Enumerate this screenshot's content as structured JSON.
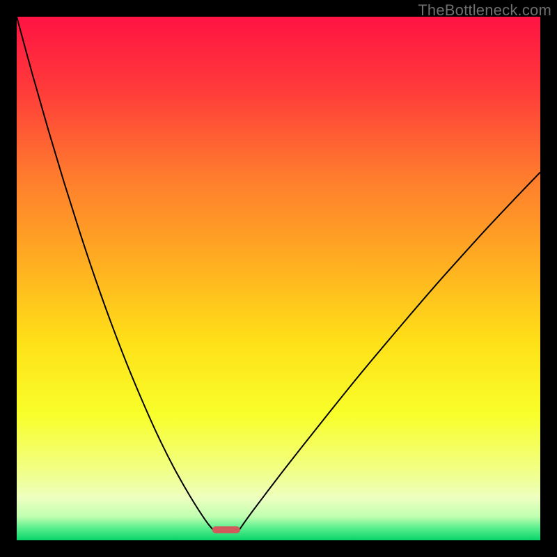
{
  "watermark": "TheBottleneck.com",
  "chart_data": {
    "type": "line",
    "title": "",
    "xlabel": "",
    "ylabel": "",
    "xlim": [
      0,
      100
    ],
    "ylim": [
      0,
      100
    ],
    "grid": false,
    "series": [
      {
        "name": "left-curve",
        "x": [
          0,
          3,
          6,
          9,
          12,
          15,
          18,
          21,
          24,
          27,
          30,
          33,
          36,
          37.5
        ],
        "y": [
          100,
          89,
          78.5,
          68.5,
          59,
          50,
          41.6,
          33.8,
          26.6,
          19.9,
          13.9,
          8.6,
          3.9,
          2.0
        ]
      },
      {
        "name": "right-curve",
        "x": [
          42.5,
          45,
          50,
          55,
          60,
          65,
          70,
          75,
          80,
          85,
          90,
          95,
          100
        ],
        "y": [
          2.0,
          5.5,
          12.1,
          18.5,
          24.8,
          31.0,
          37.0,
          42.9,
          48.7,
          54.3,
          59.8,
          65.1,
          70.3
        ]
      }
    ],
    "annotations": [
      {
        "name": "minimum-marker",
        "x": 40,
        "y": 2.0,
        "color": "#d15a5a"
      }
    ],
    "background_gradient": {
      "stops": [
        {
          "offset": 0.0,
          "color": "#ff1343"
        },
        {
          "offset": 0.14,
          "color": "#ff3b3a"
        },
        {
          "offset": 0.3,
          "color": "#ff7a2e"
        },
        {
          "offset": 0.46,
          "color": "#ffab22"
        },
        {
          "offset": 0.62,
          "color": "#ffe018"
        },
        {
          "offset": 0.76,
          "color": "#f8ff2a"
        },
        {
          "offset": 0.86,
          "color": "#f2ff80"
        },
        {
          "offset": 0.92,
          "color": "#edffc0"
        },
        {
          "offset": 0.955,
          "color": "#c0ffb0"
        },
        {
          "offset": 0.975,
          "color": "#60f090"
        },
        {
          "offset": 1.0,
          "color": "#08d468"
        }
      ]
    }
  }
}
